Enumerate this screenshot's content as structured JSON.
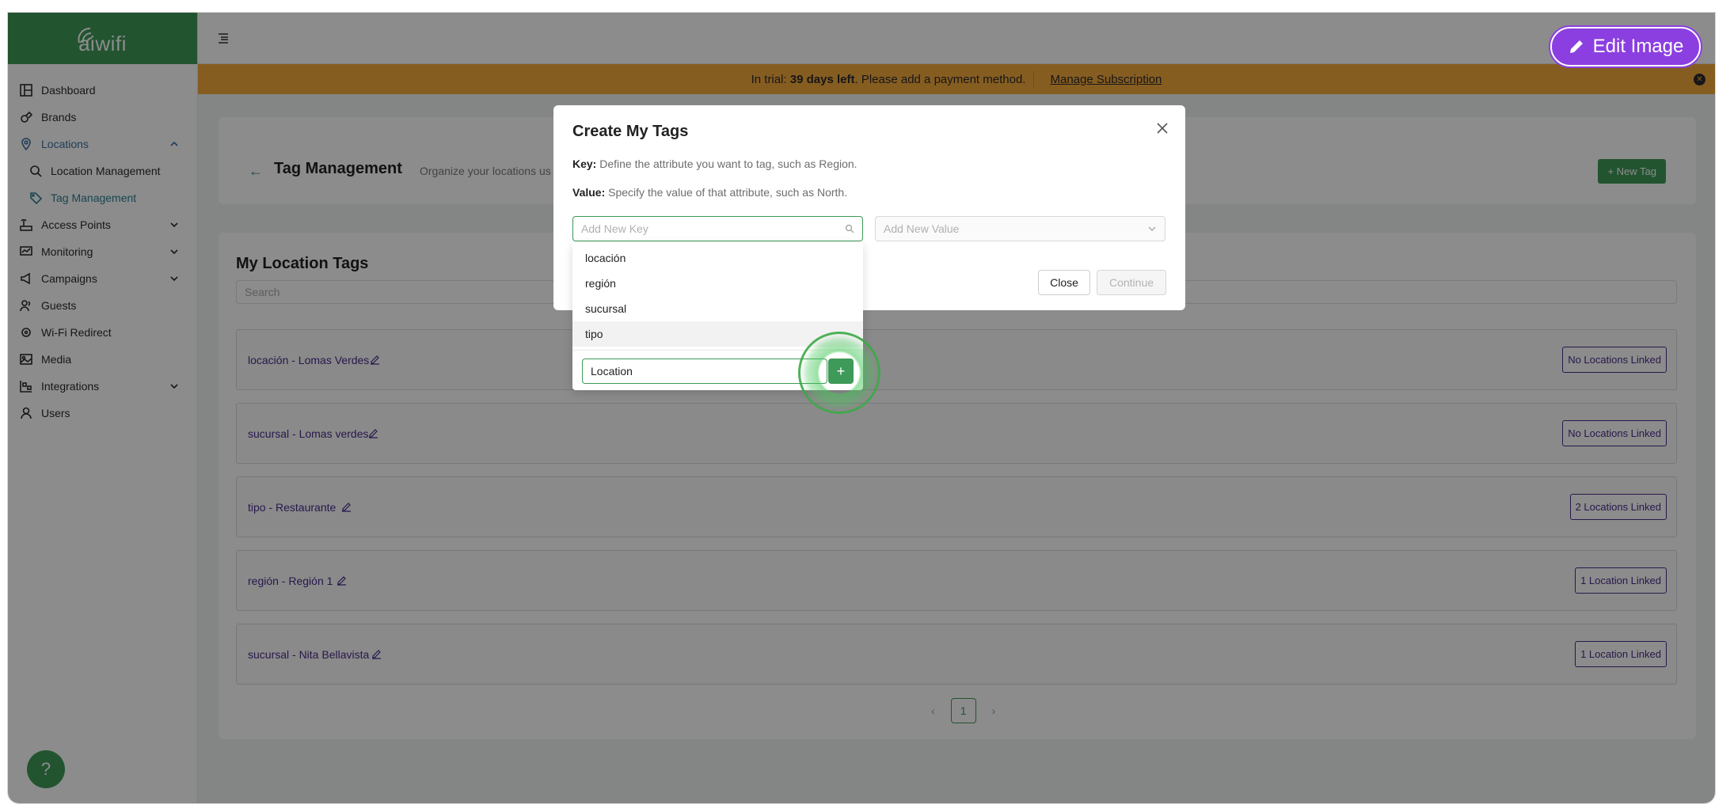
{
  "app": {
    "logo_text": "aiwifi"
  },
  "sidebar": {
    "items": [
      {
        "label": "Dashboard",
        "icon": "dashboard-icon"
      },
      {
        "label": "Brands",
        "icon": "brands-icon"
      },
      {
        "label": "Locations",
        "icon": "location-pin-icon",
        "expanded": true
      },
      {
        "label": "Location Management",
        "icon": "location-search-icon"
      },
      {
        "label": "Tag Management",
        "icon": "tag-icon"
      },
      {
        "label": "Access Points",
        "icon": "access-point-icon"
      },
      {
        "label": "Monitoring",
        "icon": "monitor-icon"
      },
      {
        "label": "Campaigns",
        "icon": "megaphone-icon"
      },
      {
        "label": "Guests",
        "icon": "guests-icon"
      },
      {
        "label": "Wi-Fi Redirect",
        "icon": "redirect-icon"
      },
      {
        "label": "Media",
        "icon": "media-icon"
      },
      {
        "label": "Integrations",
        "icon": "integrations-icon"
      },
      {
        "label": "Users",
        "icon": "user-icon"
      }
    ]
  },
  "banner": {
    "prefix": "In trial:",
    "days": "39 days left",
    "suffix": ". Please add a payment method.",
    "link": "Manage Subscription",
    "color": "#f5a93c"
  },
  "header": {
    "title": "Tag Management",
    "subtitle": "Organize your locations us",
    "new_tag_button": "+ New Tag"
  },
  "tags_list": {
    "title": "My Location Tags",
    "search_placeholder": "Search",
    "rows": [
      {
        "label": "locación - Lomas Verdes",
        "linked": "No Locations Linked"
      },
      {
        "label": "sucursal - Lomas verdes",
        "linked": "No Locations Linked"
      },
      {
        "label": "tipo - Restaurante",
        "linked": "2 Locations Linked"
      },
      {
        "label": "región - Región 1",
        "linked": "1 Location Linked"
      },
      {
        "label": "sucursal - Nita Bellavista",
        "linked": "1 Location Linked"
      }
    ],
    "pager": {
      "prev": "‹",
      "page": "1",
      "next": "›"
    }
  },
  "modal": {
    "title": "Create My Tags",
    "key_label": "Key:",
    "key_desc": "Define the attribute you want to tag, such as Region.",
    "value_label": "Value:",
    "value_desc": "Specify the value of that attribute, such as North.",
    "key_placeholder": "Add New Key",
    "value_placeholder": "Add New Value",
    "close_button": "Close",
    "continue_button": "Continue"
  },
  "dropdown": {
    "options": [
      "locación",
      "región",
      "sucursal",
      "tipo"
    ],
    "new_key_value": "Location",
    "add_button": "+"
  },
  "help_button": "?",
  "edit_image_button": "Edit Image",
  "colors": {
    "brand_green": "#3e9a58",
    "tag_purple": "#4a2d8a",
    "edit_purple": "#8b3fe0"
  }
}
